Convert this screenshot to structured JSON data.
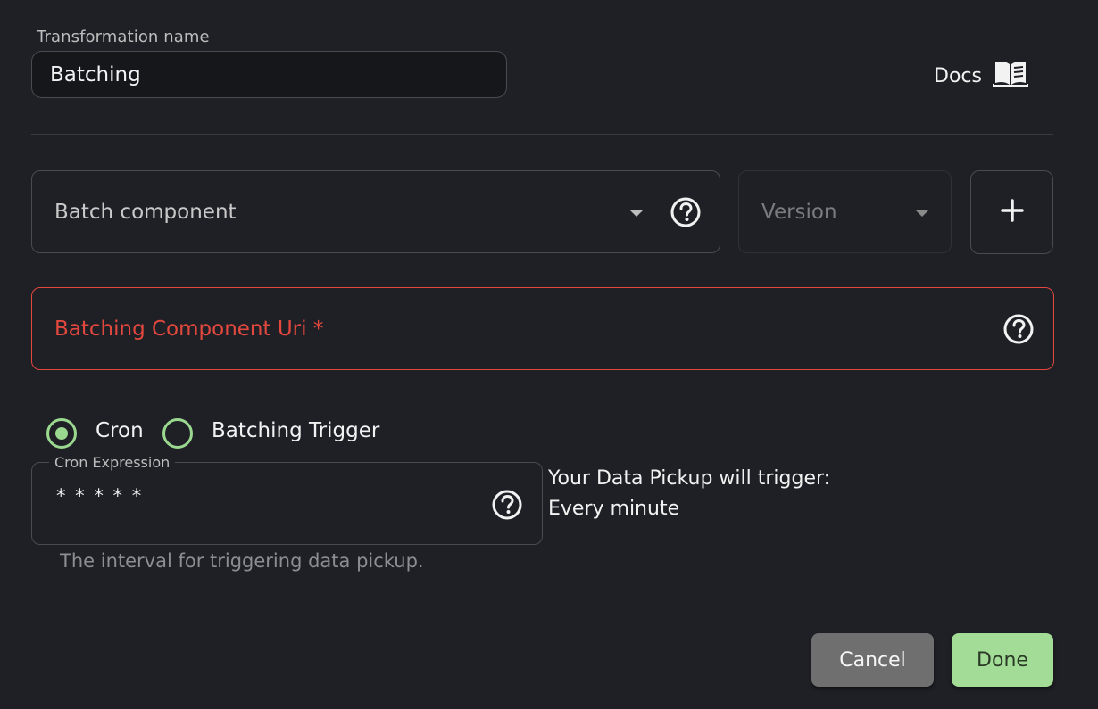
{
  "transformation": {
    "label": "Transformation name",
    "value": "Batching"
  },
  "docs": {
    "label": "Docs",
    "icon": "book-icon"
  },
  "batch_component": {
    "placeholder": "Batch component",
    "icon": "help-circle-icon"
  },
  "version": {
    "placeholder": "Version"
  },
  "add_button": {
    "icon": "plus-icon"
  },
  "uri": {
    "label": "Batching Component Uri *",
    "icon": "help-circle-icon"
  },
  "trigger_options": [
    {
      "label": "Cron",
      "selected": true
    },
    {
      "label": "Batching Trigger",
      "selected": false
    }
  ],
  "cron": {
    "label": "Cron Expression",
    "value": "* * * * *",
    "helper": "The interval for triggering data pickup."
  },
  "pickup": {
    "line1": "Your Data Pickup will trigger:",
    "line2": "Every minute"
  },
  "actions": {
    "cancel": "Cancel",
    "done": "Done"
  },
  "colors": {
    "background": "#1f2026",
    "accent": "#a3dc96",
    "error": "#e2483d"
  }
}
